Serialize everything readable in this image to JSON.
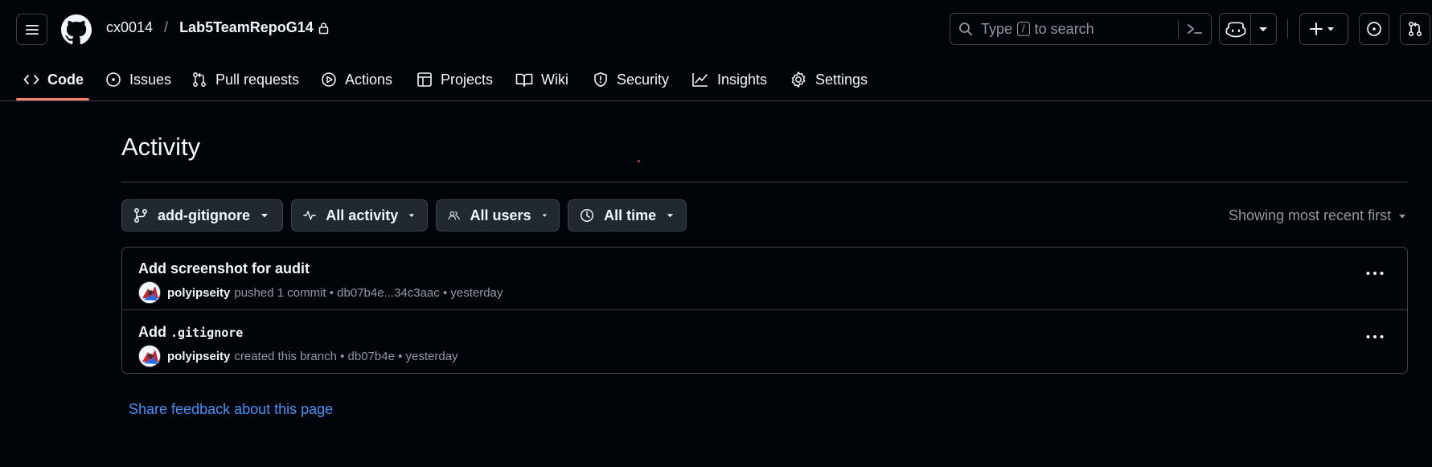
{
  "header": {
    "owner": "cx0014",
    "separator": "/",
    "repo": "Lab5TeamRepoG14",
    "search": {
      "placeholder_before": "Type",
      "shortcut_key": "/",
      "placeholder_after": "to search"
    }
  },
  "tabs": [
    {
      "label": "Code",
      "icon": "code-icon",
      "selected": true
    },
    {
      "label": "Issues",
      "icon": "issue-opened-icon"
    },
    {
      "label": "Pull requests",
      "icon": "git-pull-request-icon"
    },
    {
      "label": "Actions",
      "icon": "play-icon"
    },
    {
      "label": "Projects",
      "icon": "table-icon"
    },
    {
      "label": "Wiki",
      "icon": "book-icon"
    },
    {
      "label": "Security",
      "icon": "shield-icon"
    },
    {
      "label": "Insights",
      "icon": "graph-icon"
    },
    {
      "label": "Settings",
      "icon": "gear-icon"
    }
  ],
  "page": {
    "title": "Activity",
    "filters": {
      "branch": "add-gitignore",
      "activity": "All activity",
      "users": "All users",
      "time": "All time"
    },
    "sort": "Showing most recent first",
    "events": [
      {
        "title": "Add screenshot for audit",
        "title_code": "",
        "user": "polyipseity",
        "detail": "pushed 1 commit • db07b4e...34c3aac • yesterday"
      },
      {
        "title": "Add",
        "title_code": ".gitignore",
        "user": "polyipseity",
        "detail": "created this branch • db07b4e • yesterday"
      }
    ],
    "feedback": "Share feedback about this page"
  },
  "colors": {
    "background": "#010409",
    "border": "#3d444d",
    "text": "#f0f6fc",
    "muted": "#9198a1",
    "button_bg": "#212830",
    "link": "#4493f8",
    "tab_underline": "#f78166"
  }
}
